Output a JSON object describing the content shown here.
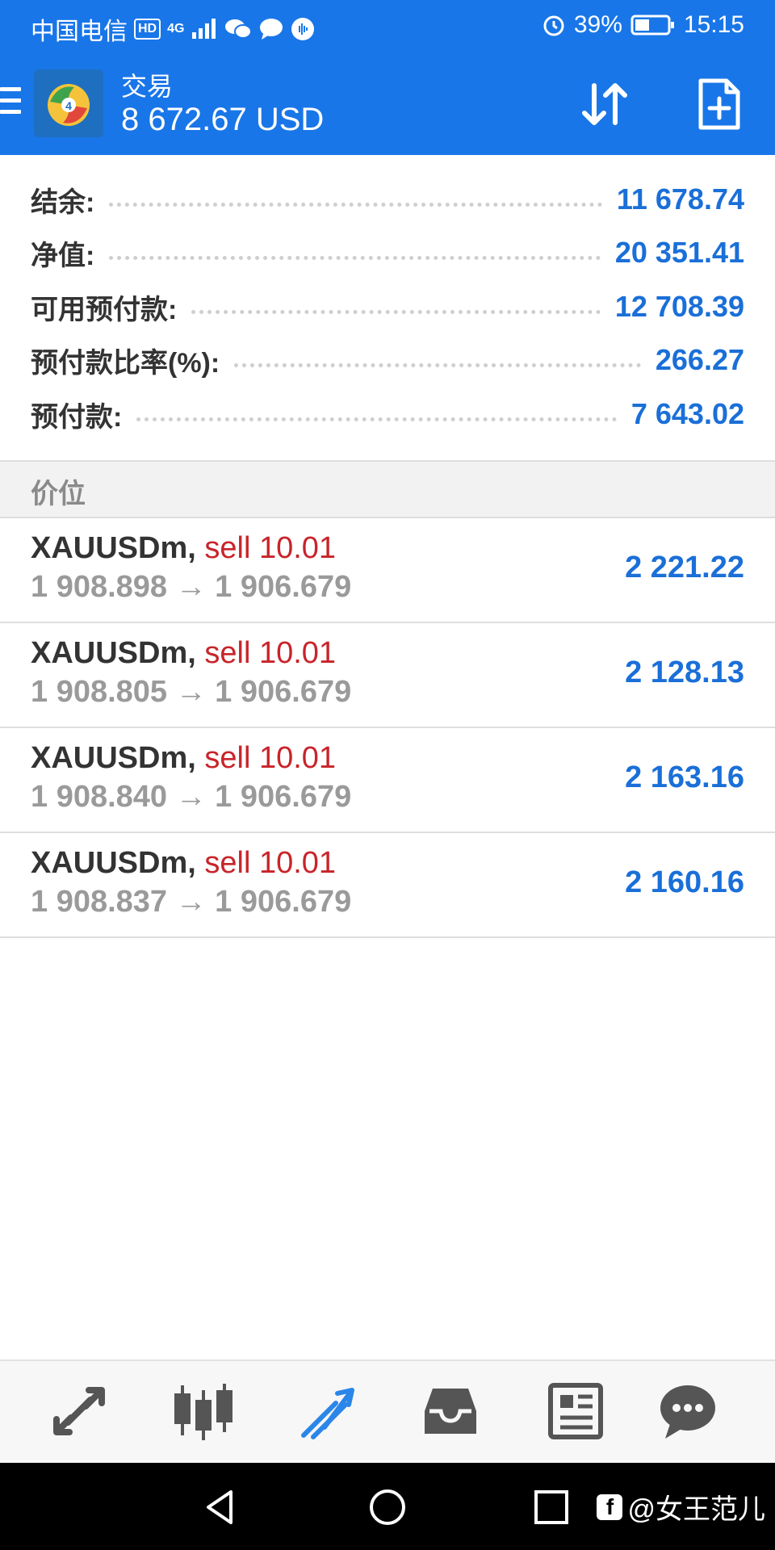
{
  "status_bar": {
    "carrier": "中国电信",
    "hd_badge": "HD",
    "network": "4G",
    "battery": "39%",
    "time": "15:15",
    "icons": [
      "hd-icon",
      "signal-icon",
      "wechat-icon",
      "message-icon",
      "audio-icon",
      "alarm-icon",
      "battery-icon"
    ]
  },
  "header": {
    "title": "交易",
    "balance": "8 672.67 USD",
    "icons": [
      "menu-icon",
      "app-logo",
      "sort-icon",
      "new-order-icon"
    ]
  },
  "summary": {
    "rows": [
      {
        "label": "结余:",
        "value": "11 678.74"
      },
      {
        "label": "净值:",
        "value": "20 351.41"
      },
      {
        "label": "可用预付款:",
        "value": "12 708.39"
      },
      {
        "label": "预付款比率(%):",
        "value": "266.27"
      },
      {
        "label": "预付款:",
        "value": "7 643.02"
      }
    ]
  },
  "positions_section": {
    "title": "价位"
  },
  "positions": [
    {
      "symbol": "XAUUSDm,",
      "type": "sell 10.01",
      "prices": "1 908.898 → 1 906.679",
      "profit": "2 221.22"
    },
    {
      "symbol": "XAUUSDm,",
      "type": "sell 10.01",
      "prices": "1 908.805 → 1 906.679",
      "profit": "2 128.13"
    },
    {
      "symbol": "XAUUSDm,",
      "type": "sell 10.01",
      "prices": "1 908.840 → 1 906.679",
      "profit": "2 163.16"
    },
    {
      "symbol": "XAUUSDm,",
      "type": "sell 10.01",
      "prices": "1 908.837 → 1 906.679",
      "profit": "2 160.16"
    }
  ],
  "tab_bar": {
    "tabs": [
      "quotes-icon",
      "chart-icon",
      "trade-icon",
      "history-icon",
      "news-icon",
      "chat-icon"
    ],
    "active_tab": "trade-icon",
    "active_color": "#2a86e8",
    "inactive_color": "#555555"
  },
  "nav_bar": {
    "buttons": [
      "back-icon",
      "home-icon",
      "recents-icon"
    ],
    "watermark": "@女王范儿"
  },
  "colors": {
    "brand": "#1976e8",
    "value_blue": "#1a6fd8",
    "sell_red": "#c8242a"
  }
}
